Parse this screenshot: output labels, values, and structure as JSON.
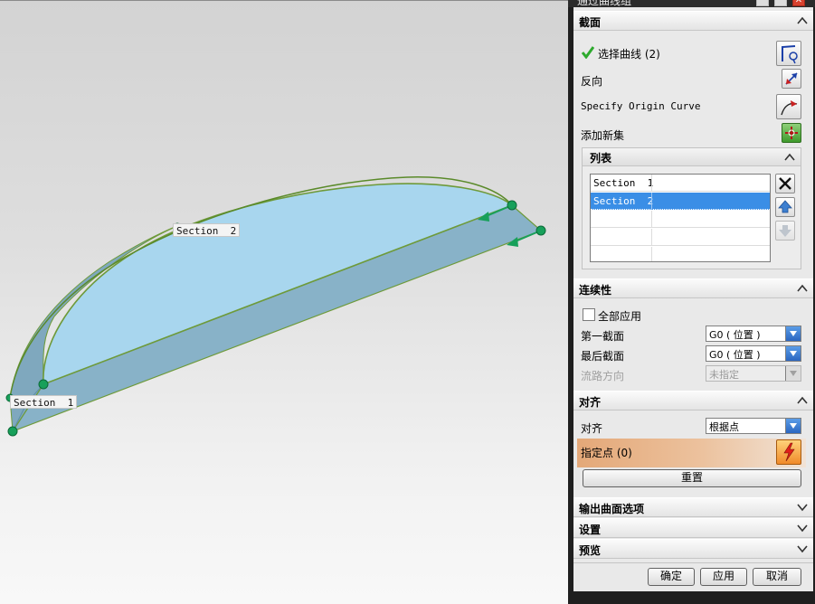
{
  "dialog": {
    "title": "通过曲线组",
    "sections": {
      "section": {
        "title": "截面",
        "select_curve_label": "选择曲线 (2)",
        "reverse_label": "反向",
        "specify_origin_label": "Specify Origin Curve",
        "add_new_set_label": "添加新集",
        "list": {
          "title": "列表",
          "rows": [
            "Section  1",
            "Section  2"
          ],
          "selected_index": 1
        }
      },
      "continuity": {
        "title": "连续性",
        "apply_all_label": "全部应用",
        "first_section_label": "第一截面",
        "first_section_value": "G0 ( 位置 )",
        "last_section_label": "最后截面",
        "last_section_value": "G0 ( 位置 )",
        "flow_direction_label": "流路方向",
        "flow_direction_value": "未指定"
      },
      "alignment": {
        "title": "对齐",
        "align_label": "对齐",
        "align_value": "根据点",
        "specify_point_label": "指定点 (0)",
        "reset_label": "重置"
      },
      "output_options": {
        "title": "输出曲面选项"
      },
      "settings": {
        "title": "设置"
      },
      "preview": {
        "title": "预览"
      }
    },
    "buttons": {
      "ok": "确定",
      "apply": "应用",
      "cancel": "取消"
    }
  },
  "viewport": {
    "section_labels": [
      "Section  1",
      "Section  2"
    ]
  },
  "colors": {
    "surface": "#a8d4ec",
    "side_surface": "#8ab4cc",
    "edge": "#6e9a3a",
    "handle": "#17a05a",
    "selection": "#3a8ee6",
    "highlight_row": "#e4a878"
  }
}
